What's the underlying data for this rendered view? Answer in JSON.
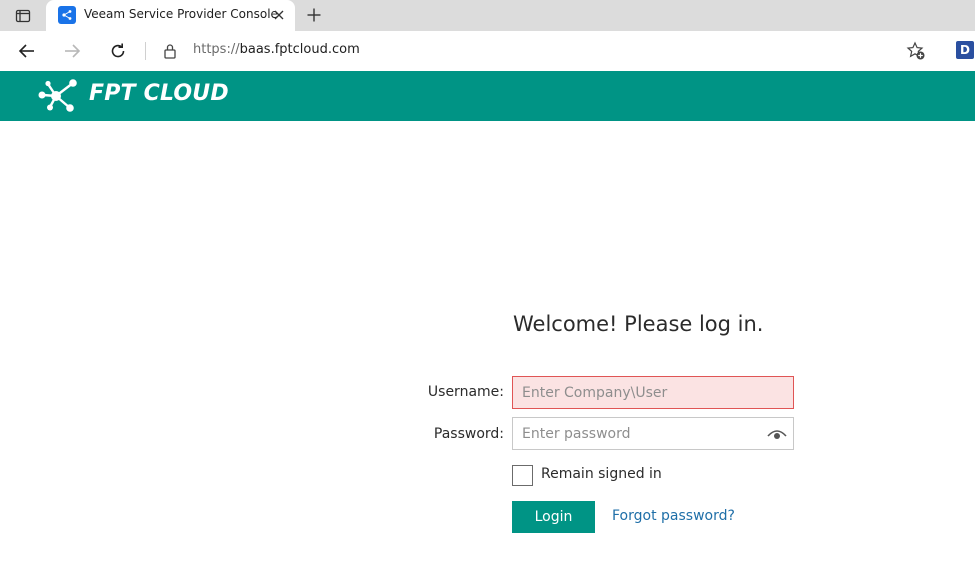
{
  "browser": {
    "tab_title": "Veeam Service Provider Console",
    "url_protocol": "https://",
    "url_host": "baas.fptcloud.com",
    "profile_initial": "D"
  },
  "banner": {
    "logo_text": "FPT CLOUD",
    "color": "#009485"
  },
  "login": {
    "welcome": "Welcome! Please log in.",
    "username_label": "Username:",
    "username_placeholder": "Enter Company\\User",
    "password_label": "Password:",
    "password_placeholder": "Enter password",
    "remember_label": "Remain signed in",
    "login_button": "Login",
    "forgot_link": "Forgot password?"
  },
  "icons": {
    "tab_actions": "tab-actions-icon",
    "favicon": "veeam-favicon-icon",
    "close": "close-icon",
    "new_tab": "plus-icon",
    "back": "back-arrow-icon",
    "forward": "forward-arrow-icon",
    "refresh": "refresh-icon",
    "lock": "lock-icon",
    "favorite": "add-favorite-icon",
    "show_password": "eye-icon"
  }
}
